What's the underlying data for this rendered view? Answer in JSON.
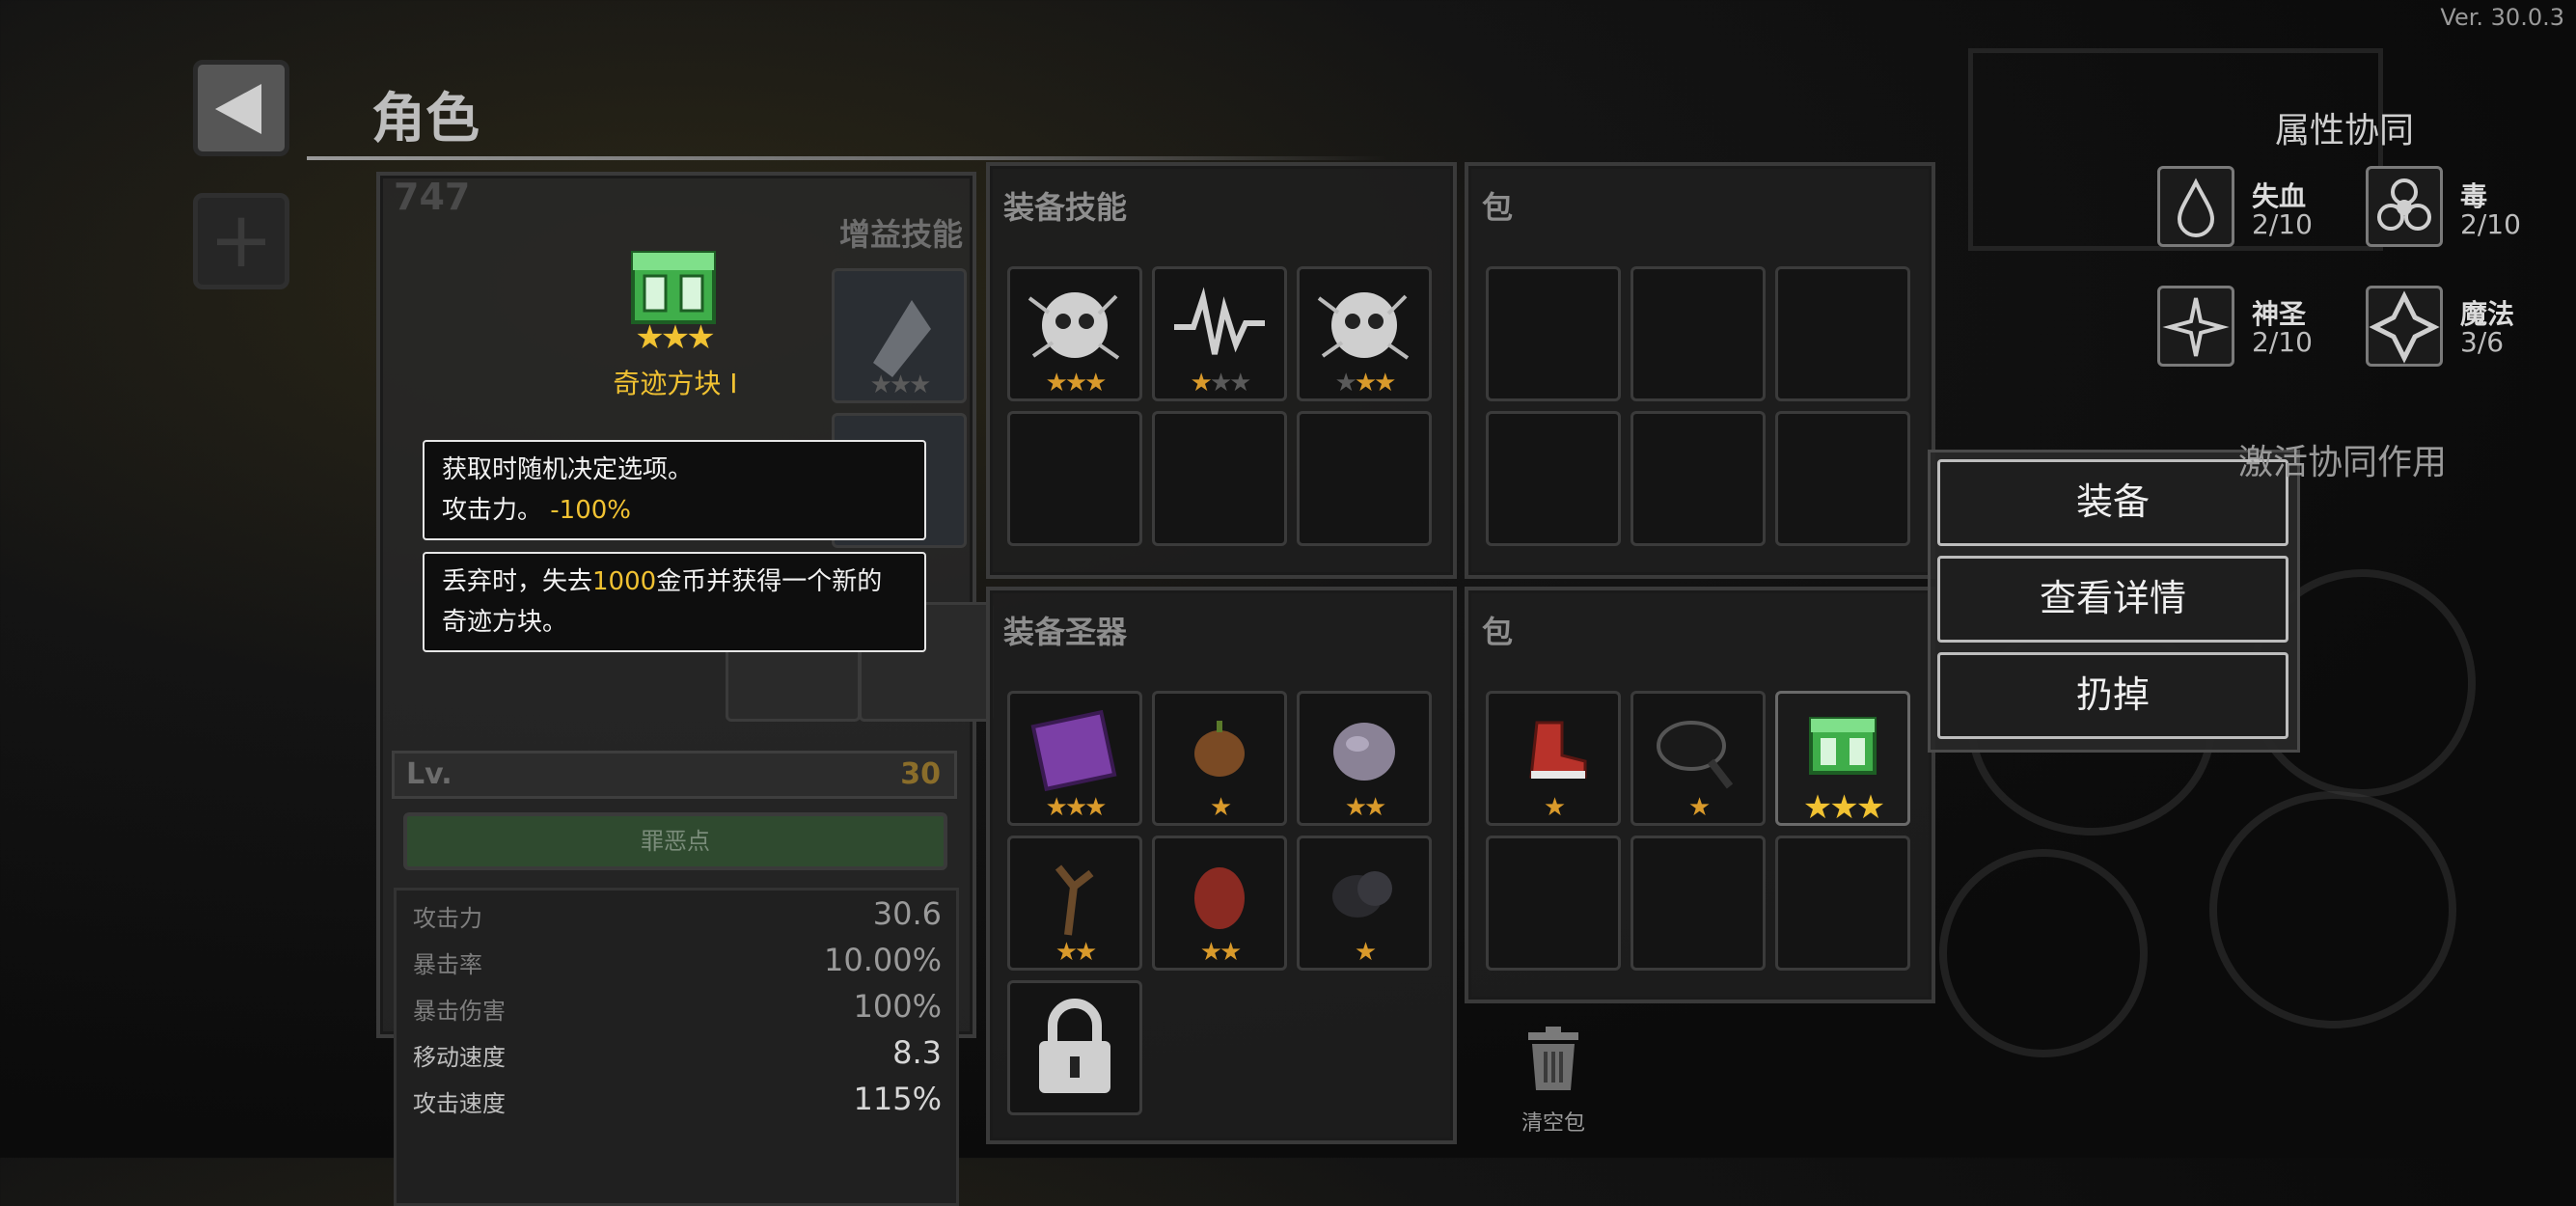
{
  "version": "Ver. 30.0.3",
  "screen_title": "角色",
  "character_panel": {
    "counter": "747",
    "buff_skills_label": "增益技能",
    "level_label": "Lv.",
    "level_value": "30",
    "sin_points_label": "罪恶点",
    "stats": [
      {
        "label": "攻击力",
        "value": "30.6"
      },
      {
        "label": "暴击率",
        "value": "10.00%"
      },
      {
        "label": "暴击伤害",
        "value": "100%"
      },
      {
        "label": "移动速度",
        "value": "8.3"
      },
      {
        "label": "攻击速度",
        "value": "115%"
      }
    ]
  },
  "selected_item": {
    "name": "奇迹方块 I",
    "stars": "★★★",
    "tooltip1_line1": "获取时随机决定选项。",
    "tooltip1_line2_prefix": "攻击力。",
    "tooltip1_line2_value": "-100%",
    "tooltip2_prefix": "丢弃时，失去",
    "tooltip2_amount": "1000",
    "tooltip2_suffix": "金币并获得一个新的",
    "tooltip2_line2": "奇迹方块。"
  },
  "equip_skills": {
    "title": "装备技能",
    "slots": [
      {
        "icon": "skull-splash-icon",
        "stars": "★★★",
        "level": 3
      },
      {
        "icon": "soundwave-icon",
        "stars": "★★★",
        "level": 1
      },
      {
        "icon": "skull-splash-icon",
        "stars": "★★★",
        "level": 2
      }
    ]
  },
  "equip_relics": {
    "title": "装备圣器",
    "slots": [
      {
        "icon": "purple-book-icon",
        "stars": "★★★"
      },
      {
        "icon": "fruit-icon",
        "stars": "★"
      },
      {
        "icon": "crystal-rock-icon",
        "stars": "★★"
      },
      {
        "icon": "twig-icon",
        "stars": "★★"
      },
      {
        "icon": "red-seed-icon",
        "stars": "★★"
      },
      {
        "icon": "dark-stone-icon",
        "stars": "★"
      }
    ]
  },
  "bag_top": {
    "title": "包"
  },
  "bag_bottom": {
    "title": "包",
    "slots": [
      {
        "icon": "red-boot-icon",
        "stars": "★"
      },
      {
        "icon": "frying-pan-icon",
        "stars": "★"
      },
      {
        "icon": "miracle-cube-icon",
        "stars": "★★★"
      }
    ],
    "clear_label": "清空包"
  },
  "context_menu": {
    "equip": "装备",
    "details": "查看详情",
    "discard": "扔掉"
  },
  "synergy": {
    "title": "属性协同",
    "items": [
      {
        "name": "失血",
        "count": "2/10",
        "icon": "blood-drop-icon"
      },
      {
        "name": "毒",
        "count": "2/10",
        "icon": "biohazard-icon"
      },
      {
        "name": "神圣",
        "count": "2/10",
        "icon": "holy-star-icon"
      },
      {
        "name": "魔法",
        "count": "3/6",
        "icon": "magic-diamond-icon"
      }
    ],
    "activate_label": "激活协同作用"
  },
  "colors": {
    "gold": "#f1c232",
    "star": "#d99a2b",
    "green_bar": "#2f4a2f"
  }
}
